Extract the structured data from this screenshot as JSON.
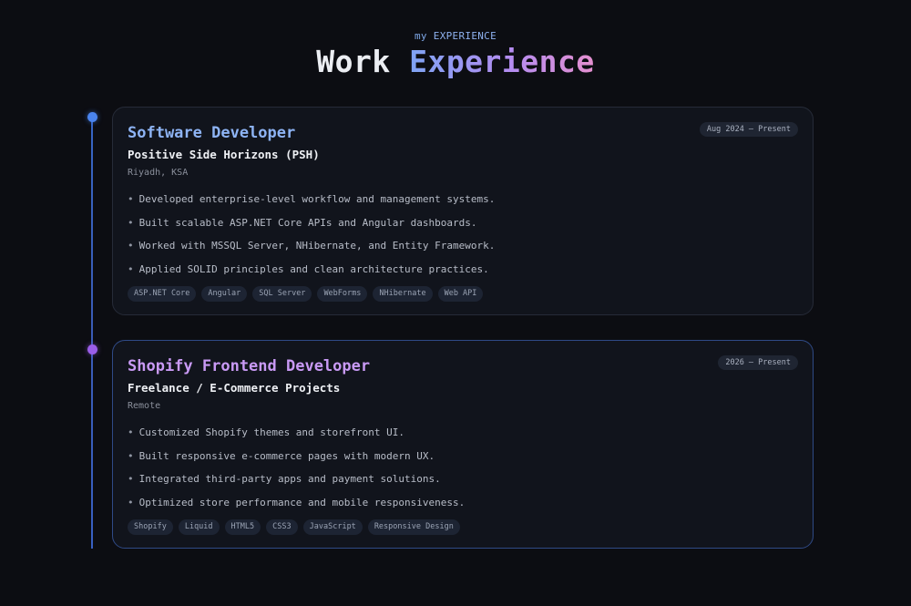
{
  "header": {
    "eyebrow_prefix": "my",
    "eyebrow_highlight": "EXPERIENCE",
    "title_plain": "Work",
    "title_gradient": "Experience"
  },
  "colors": {
    "background": "#0c0d12",
    "accent_blue": "#8eb4f5",
    "accent_purple": "#c99af5",
    "timeline": "#3b6fd8"
  },
  "experiences": [
    {
      "role": "Software Developer",
      "company": "Positive Side Horizons (PSH)",
      "location": "Riyadh, KSA",
      "dates": "Aug 2024 – Present",
      "bullets": [
        "Developed enterprise-level workflow and management systems.",
        "Built scalable ASP.NET Core APIs and Angular dashboards.",
        "Worked with MSSQL Server, NHibernate, and Entity Framework.",
        "Applied SOLID principles and clean architecture practices."
      ],
      "tags": [
        "ASP.NET Core",
        "Angular",
        "SQL Server",
        "WebForms",
        "NHibernate",
        "Web API"
      ]
    },
    {
      "role": "Shopify Frontend Developer",
      "company": "Freelance / E-Commerce Projects",
      "location": "Remote",
      "dates": "2026 – Present",
      "bullets": [
        "Customized Shopify themes and storefront UI.",
        "Built responsive e-commerce pages with modern UX.",
        "Integrated third-party apps and payment solutions.",
        "Optimized store performance and mobile responsiveness."
      ],
      "tags": [
        "Shopify",
        "Liquid",
        "HTML5",
        "CSS3",
        "JavaScript",
        "Responsive Design"
      ]
    }
  ]
}
